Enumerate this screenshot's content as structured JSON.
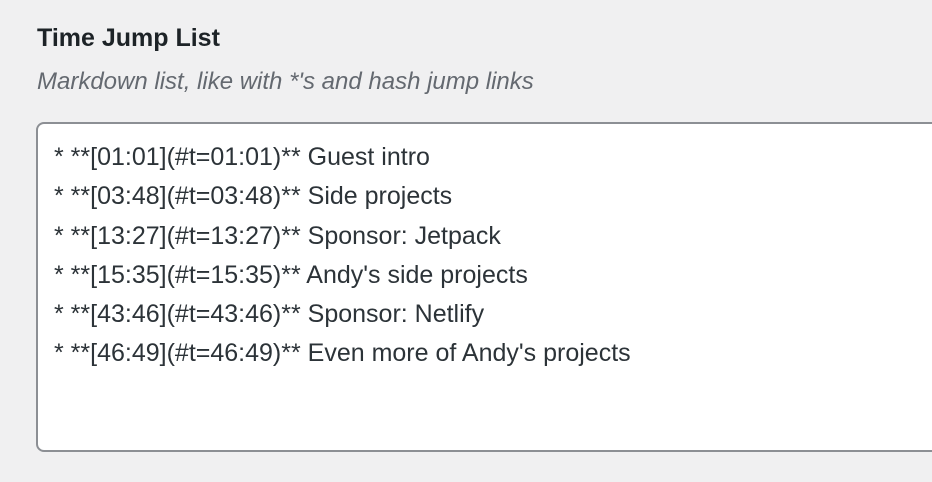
{
  "field": {
    "label": "Time Jump List",
    "description": "Markdown list, like with *'s and hash jump links"
  },
  "textarea": {
    "lines": [
      "* **[01:01](#t=01:01)** Guest intro",
      "* **[03:48](#t=03:48)** Side projects",
      "* **[13:27](#t=13:27)** Sponsor: Jetpack",
      "* **[15:35](#t=15:35)** Andy's side projects",
      "* **[43:46](#t=43:46)** Sponsor: Netlify",
      "* **[46:49](#t=46:49)** Even more of Andy's projects"
    ]
  },
  "colors": {
    "page_background": "#f0f0f1",
    "textarea_border": "#8c8f94",
    "label_text": "#1d2327",
    "description_text": "#646970"
  }
}
